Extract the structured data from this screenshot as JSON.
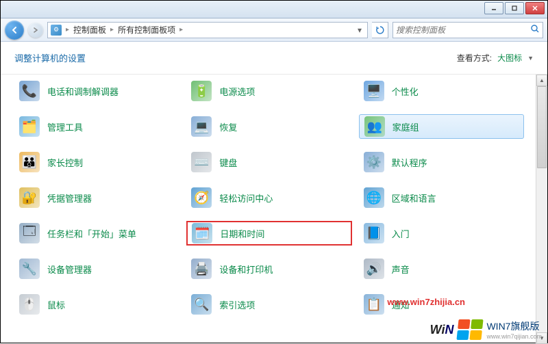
{
  "titlebar": {
    "minimize": "–",
    "maximize": "□",
    "close": "×"
  },
  "nav": {
    "breadcrumb": {
      "root": "控制面板",
      "current": "所有控制面板项"
    },
    "search_placeholder": "搜索控制面板"
  },
  "header": {
    "title": "调整计算机的设置",
    "viewby_label": "查看方式:",
    "viewby_value": "大图标"
  },
  "items": [
    {
      "id": "phone-modem",
      "label": "电话和调制解调器",
      "icon": "📞",
      "bg": "#5a8fc8"
    },
    {
      "id": "power-options",
      "label": "电源选项",
      "icon": "🔋",
      "bg": "#4caf50"
    },
    {
      "id": "personalization",
      "label": "个性化",
      "icon": "🖥️",
      "bg": "#4a90d8"
    },
    {
      "id": "admin-tools",
      "label": "管理工具",
      "icon": "🗂️",
      "bg": "#5aa8d8"
    },
    {
      "id": "recovery",
      "label": "恢复",
      "icon": "💻",
      "bg": "#6a9acc"
    },
    {
      "id": "homegroup",
      "label": "家庭组",
      "icon": "👥",
      "bg": "#5ab85a",
      "selected": true
    },
    {
      "id": "parental-controls",
      "label": "家长控制",
      "icon": "👪",
      "bg": "#e8a838"
    },
    {
      "id": "keyboard",
      "label": "键盘",
      "icon": "⌨️",
      "bg": "#b0b8c0"
    },
    {
      "id": "default-programs",
      "label": "默认程序",
      "icon": "⚙️",
      "bg": "#6a9acc"
    },
    {
      "id": "credential-manager",
      "label": "凭据管理器",
      "icon": "🔐",
      "bg": "#d8b038"
    },
    {
      "id": "ease-of-access",
      "label": "轻松访问中心",
      "icon": "🧭",
      "bg": "#3a8cc8"
    },
    {
      "id": "region-language",
      "label": "区域和语言",
      "icon": "🌐",
      "bg": "#3a8cc8"
    },
    {
      "id": "taskbar-start",
      "label": "任务栏和「开始」菜单",
      "icon": "🗔",
      "bg": "#7a9ab8"
    },
    {
      "id": "date-time",
      "label": "日期和时间",
      "icon": "🗓️",
      "bg": "#5aa8d0",
      "highlighted": true
    },
    {
      "id": "getting-started",
      "label": "入门",
      "icon": "📘",
      "bg": "#6aa8d8"
    },
    {
      "id": "device-manager",
      "label": "设备管理器",
      "icon": "🔧",
      "bg": "#8aa8c8"
    },
    {
      "id": "devices-printers",
      "label": "设备和打印机",
      "icon": "🖨️",
      "bg": "#7a9ac0"
    },
    {
      "id": "sound",
      "label": "声音",
      "icon": "🔊",
      "bg": "#9aa8b8"
    },
    {
      "id": "mouse",
      "label": "鼠标",
      "icon": "🖱️",
      "bg": "#b8c0c8"
    },
    {
      "id": "indexing-options",
      "label": "索引选项",
      "icon": "🔍",
      "bg": "#5a9acc"
    },
    {
      "id": "notification",
      "label": "通知",
      "icon": "📋",
      "bg": "#6aa0d0"
    }
  ],
  "watermark": "www.win7zhijia.cn",
  "brand": {
    "text": "WIN7旗舰版",
    "sub": "www.win7qijian.com"
  }
}
